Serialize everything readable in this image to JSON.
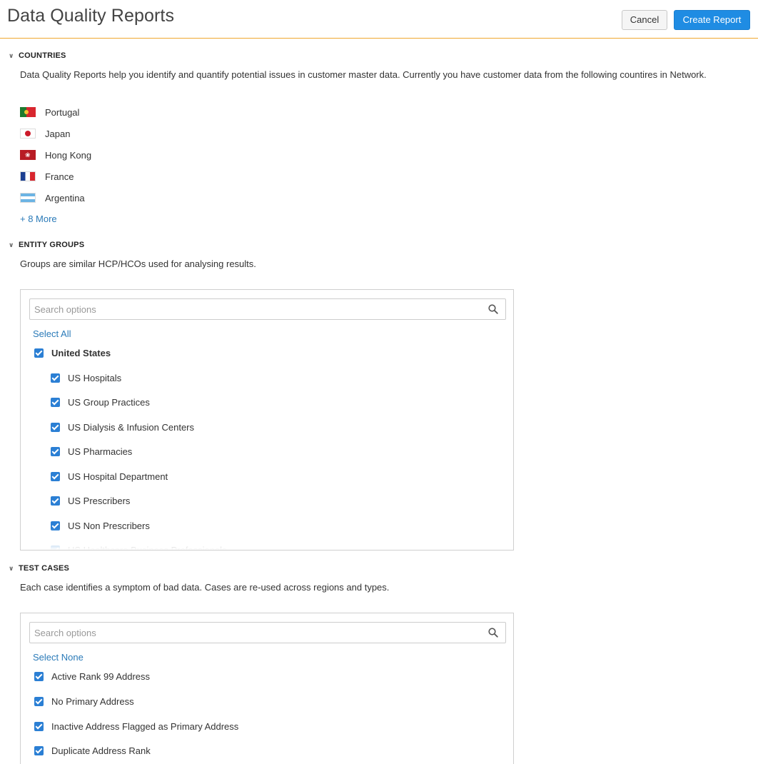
{
  "header": {
    "title": "Data Quality Reports",
    "cancel_label": "Cancel",
    "create_label": "Create Report"
  },
  "countries": {
    "heading": "COUNTRIES",
    "description": "Data Quality Reports help you identify and quantify potential issues in customer master data. Currently you have customer data from the following countires in Network.",
    "items": [
      {
        "label": "Portugal",
        "flag": "portugal-flag-icon"
      },
      {
        "label": "Japan",
        "flag": "japan-flag-icon"
      },
      {
        "label": "Hong Kong",
        "flag": "hong-kong-flag-icon"
      },
      {
        "label": "France",
        "flag": "france-flag-icon"
      },
      {
        "label": "Argentina",
        "flag": "argentina-flag-icon"
      }
    ],
    "more_label": "+ 8 More"
  },
  "entity_groups": {
    "heading": "ENTITY GROUPS",
    "description": "Groups are similar HCP/HCOs used for analysing results.",
    "search_placeholder": "Search options",
    "select_label": "Select All",
    "parent": {
      "label": "United States",
      "checked": true
    },
    "items": [
      {
        "label": "US Hospitals",
        "checked": true
      },
      {
        "label": "US Group Practices",
        "checked": true
      },
      {
        "label": "US Dialysis & Infusion Centers",
        "checked": true
      },
      {
        "label": "US Pharmacies",
        "checked": true
      },
      {
        "label": "US Hospital Department",
        "checked": true
      },
      {
        "label": "US Prescribers",
        "checked": true
      },
      {
        "label": "US Non Prescribers",
        "checked": true
      },
      {
        "label": "US Healthcare Business Professionals",
        "checked": true
      }
    ]
  },
  "test_cases": {
    "heading": "TEST CASES",
    "description": "Each case identifies a symptom of bad data. Cases are re-used across regions and types.",
    "search_placeholder": "Search options",
    "select_label": "Select None",
    "items": [
      {
        "label": "Active Rank 99 Address",
        "checked": true
      },
      {
        "label": "No Primary Address",
        "checked": true
      },
      {
        "label": "Inactive Address Flagged as Primary Address",
        "checked": true
      },
      {
        "label": "Duplicate Address Rank",
        "checked": true
      }
    ]
  },
  "colors": {
    "accent": "#f0a830",
    "primary_button": "#1f8ce3",
    "link": "#2a7ab8",
    "checkbox": "#2b7fd4"
  }
}
